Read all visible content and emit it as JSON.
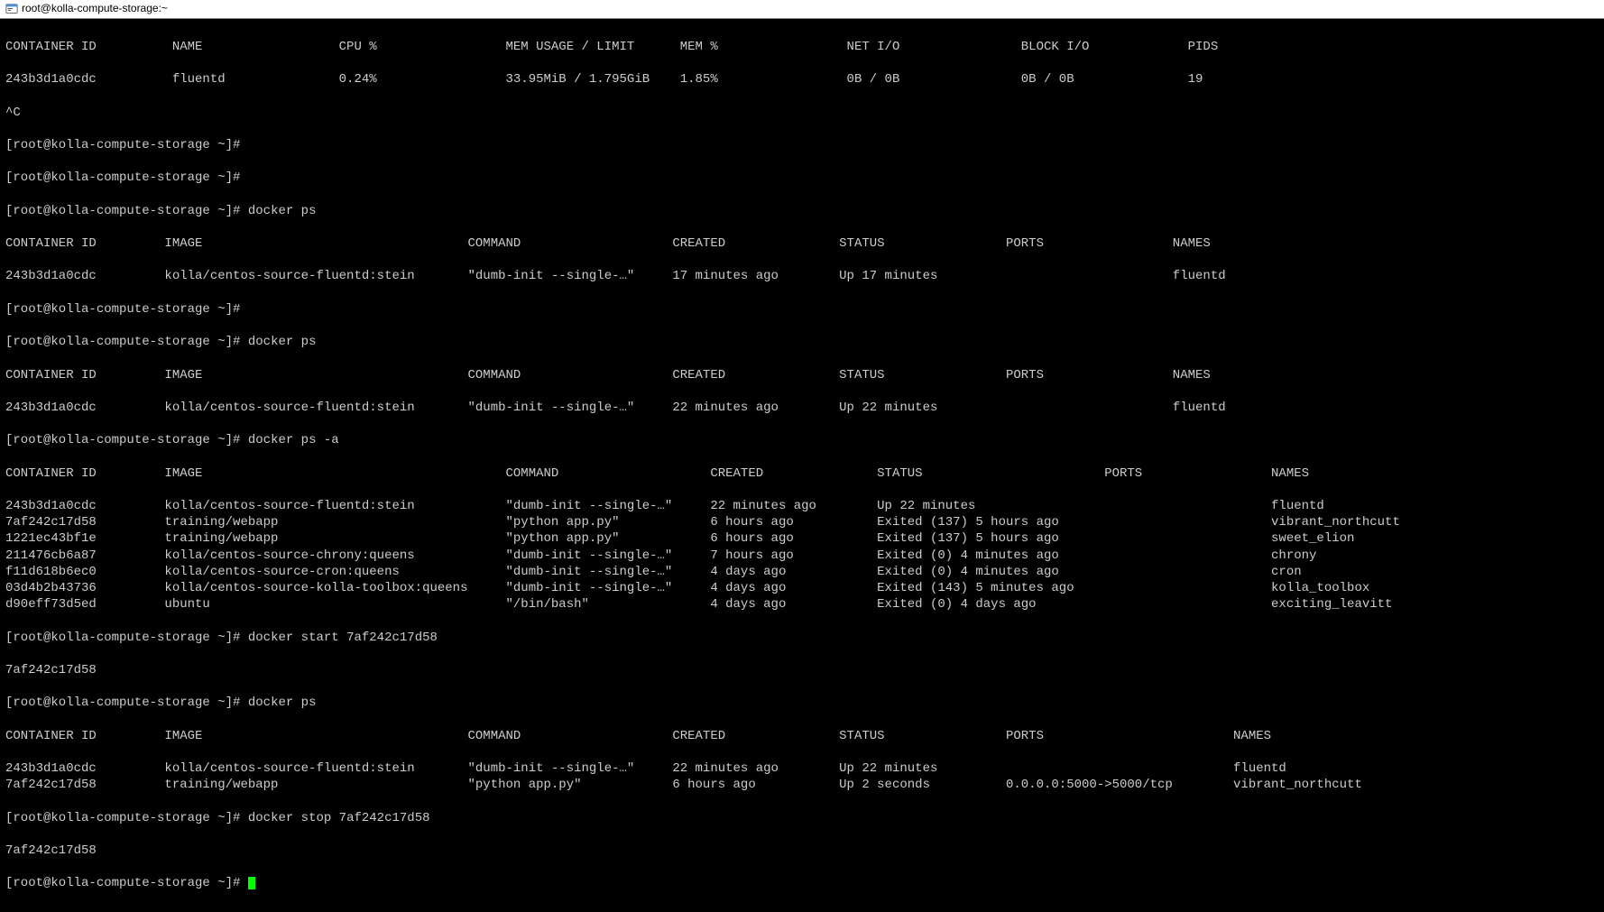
{
  "window": {
    "title": "root@kolla-compute-storage:~"
  },
  "prompt": "[root@kolla-compute-storage ~]#",
  "stats": {
    "headers": [
      "CONTAINER ID",
      "NAME",
      "CPU %",
      "MEM USAGE / LIMIT",
      "MEM %",
      "NET I/O",
      "BLOCK I/O",
      "PIDS"
    ],
    "row": [
      "243b3d1a0cdc",
      "fluentd",
      "0.24%",
      "33.95MiB / 1.795GiB",
      "1.85%",
      "0B / 0B",
      "0B / 0B",
      "19"
    ]
  },
  "break": "^C",
  "cmd_ps": "docker ps",
  "cmd_ps_a": "docker ps -a",
  "cmd_start": "docker start 7af242c17d58",
  "cmd_stop": "docker stop 7af242c17d58",
  "start_output": "7af242c17d58",
  "stop_output": "7af242c17d58",
  "ps_headers": [
    "CONTAINER ID",
    "IMAGE",
    "COMMAND",
    "CREATED",
    "STATUS",
    "PORTS",
    "NAMES"
  ],
  "ps1": {
    "rows": [
      [
        "243b3d1a0cdc",
        "kolla/centos-source-fluentd:stein",
        "\"dumb-init --single-…\"",
        "17 minutes ago",
        "Up 17 minutes",
        "",
        "fluentd"
      ]
    ]
  },
  "ps2": {
    "rows": [
      [
        "243b3d1a0cdc",
        "kolla/centos-source-fluentd:stein",
        "\"dumb-init --single-…\"",
        "22 minutes ago",
        "Up 22 minutes",
        "",
        "fluentd"
      ]
    ]
  },
  "psa": {
    "rows": [
      [
        "243b3d1a0cdc",
        "kolla/centos-source-fluentd:stein",
        "\"dumb-init --single-…\"",
        "22 minutes ago",
        "Up 22 minutes",
        "",
        "fluentd"
      ],
      [
        "7af242c17d58",
        "training/webapp",
        "\"python app.py\"",
        "6 hours ago",
        "Exited (137) 5 hours ago",
        "",
        "vibrant_northcutt"
      ],
      [
        "1221ec43bf1e",
        "training/webapp",
        "\"python app.py\"",
        "6 hours ago",
        "Exited (137) 5 hours ago",
        "",
        "sweet_elion"
      ],
      [
        "211476cb6a87",
        "kolla/centos-source-chrony:queens",
        "\"dumb-init --single-…\"",
        "7 hours ago",
        "Exited (0) 4 minutes ago",
        "",
        "chrony"
      ],
      [
        "f11d618b6ec0",
        "kolla/centos-source-cron:queens",
        "\"dumb-init --single-…\"",
        "4 days ago",
        "Exited (0) 4 minutes ago",
        "",
        "cron"
      ],
      [
        "03d4b2b43736",
        "kolla/centos-source-kolla-toolbox:queens",
        "\"dumb-init --single-…\"",
        "4 days ago",
        "Exited (143) 5 minutes ago",
        "",
        "kolla_toolbox"
      ],
      [
        "d90eff73d5ed",
        "ubuntu",
        "\"/bin/bash\"",
        "4 days ago",
        "Exited (0) 4 days ago",
        "",
        "exciting_leavitt"
      ]
    ]
  },
  "ps3": {
    "rows": [
      [
        "243b3d1a0cdc",
        "kolla/centos-source-fluentd:stein",
        "\"dumb-init --single-…\"",
        "22 minutes ago",
        "Up 22 minutes",
        "",
        "fluentd"
      ],
      [
        "7af242c17d58",
        "training/webapp",
        "\"python app.py\"",
        "6 hours ago",
        "Up 2 seconds",
        "0.0.0.0:5000->5000/tcp",
        "vibrant_northcutt"
      ]
    ]
  },
  "cols": {
    "stats": [
      22,
      22,
      22,
      23,
      22,
      23,
      22,
      10
    ],
    "ps": [
      21,
      40,
      27,
      22,
      22,
      22,
      20
    ],
    "psa": [
      21,
      45,
      27,
      22,
      30,
      22,
      20
    ],
    "ps3": [
      21,
      40,
      27,
      22,
      22,
      30,
      20
    ]
  }
}
